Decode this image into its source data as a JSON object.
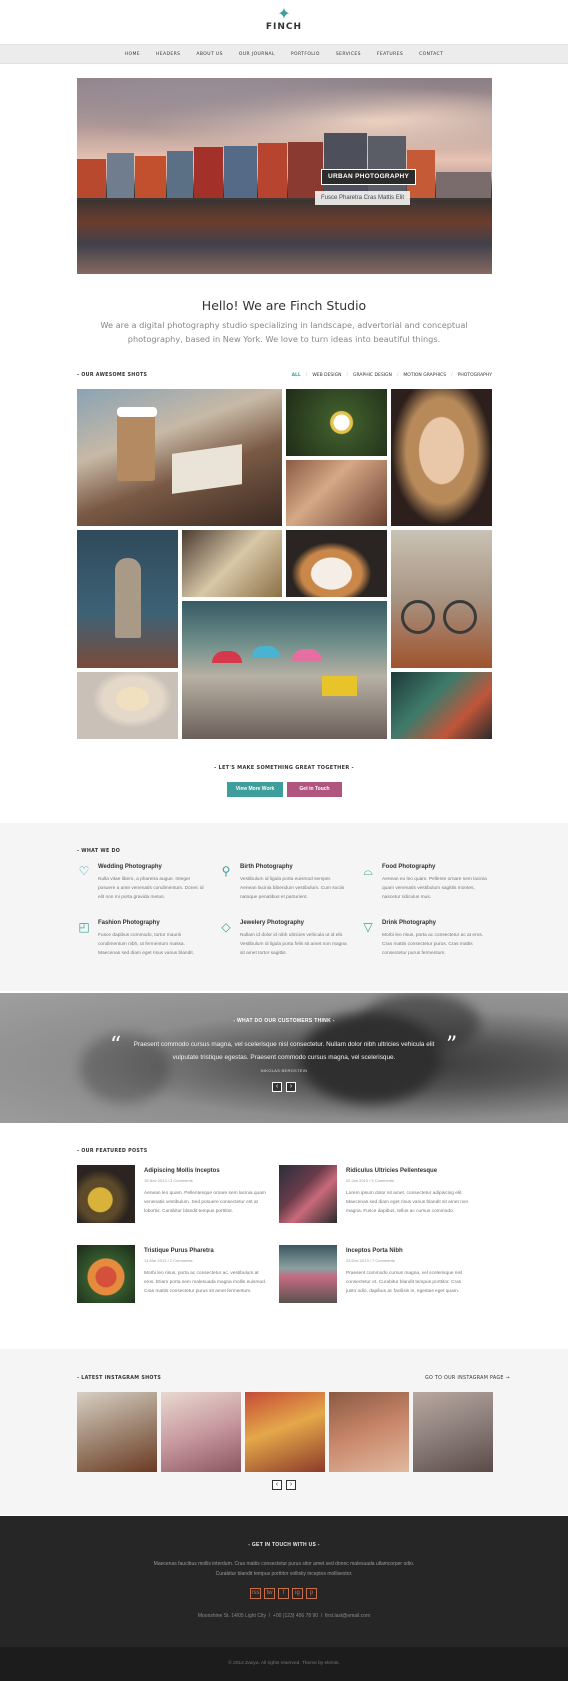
{
  "brand": {
    "logo_text": "FINCH",
    "accent": "#3e9e9c",
    "accent2": "#b0567e"
  },
  "nav": [
    "HOME",
    "HEADERS",
    "ABOUT US",
    "OUR JOURNAL",
    "PORTFOLIO",
    "SERVICES",
    "FEATURES",
    "CONTACT"
  ],
  "hero": {
    "title": "URBAN PHOTOGRAPHY",
    "subtitle": "Fusce Pharetra Cras Mattis Elit"
  },
  "intro": {
    "heading": "Hello! We are Finch Studio",
    "text": "We are a digital photography studio specializing in landscape, advertorial and conceptual photography, based in New York. We love to turn ideas into beautiful things."
  },
  "portfolio": {
    "label": "- OUR AWESOME SHOTS",
    "filters": [
      "ALL",
      "WEB DESIGN",
      "GRAPHIC DESIGN",
      "MOTION GRAPHICS",
      "PHOTOGRAPHY"
    ]
  },
  "cta": {
    "heading": "- LET'S MAKE SOMETHING GREAT TOGETHER -",
    "btn_work": "View More Work",
    "btn_touch": "Get in Touch"
  },
  "services": {
    "label": "- WHAT WE DO",
    "items": [
      {
        "title": "Wedding Photography",
        "icon": "heart-icon",
        "desc": "Nulla vitae libero, a pharetra augue. Integer posuere a ante venenatis condimentum. Donec id elit non mi porta gravida metus."
      },
      {
        "title": "Birth Photography",
        "icon": "lightbulb-icon",
        "desc": "Vestibulum id ligula porta euismod semper. Aenean lacinia bibendum vestibulum. Cum sociis natoque penatibus et parturient."
      },
      {
        "title": "Food Photography",
        "icon": "cloche-icon",
        "desc": "Aenean eu leo quam. Pellente ornare sem lacinia quam venenatis vestibulum sagittis montes, nascetur ridiculus mus."
      },
      {
        "title": "Fashion Photography",
        "icon": "bag-icon",
        "desc": "Fusce dapibus commodo, tortor mauris condimentum nibh, ut fermentum massa. Maecenas sed diam eget risus varius blandit."
      },
      {
        "title": "Jewelery Photography",
        "icon": "diamond-icon",
        "desc": "Nullam id dolor id nibh ultricies vehicula ut id elit. Vestibulum id ligula porta felis sit amet non magna sit amet tortor sagittis."
      },
      {
        "title": "Drink Photography",
        "icon": "cocktail-icon",
        "desc": "Morbi leo risus, porta ac consectetur ac at eros. Cras mattis consectetur purus. Cras mattis consectetur purus fermentum."
      }
    ]
  },
  "testimonial": {
    "heading": "- WHAT DO OUR CUSTOMERS THINK -",
    "quote": "Praesent commodo cursus magna, vel scelerisque nisl consectetur. Nullam dolor nibh ultricies vehicula elit vulputate tristique egestas. Praesent commodo cursus magna, vel scelerisque.",
    "author": "NIKOLAS BERGSTEIN"
  },
  "posts": {
    "label": "- OUR FEATURED POSTS",
    "items": [
      {
        "title": "Adipiscing Mollis Inceptos",
        "meta": "15 Nov 2013  /  3 Comments",
        "desc": "Aenean leo quam. Pellentesque ornare sem lacinia quam venenatis vestibulum. Sed posuere consectetur est at lobortis. Curabitur blandit tempus porttitor."
      },
      {
        "title": "Ridiculus Ultricies Pellentesque",
        "meta": "02 Jan 2013  /  5 Comments",
        "desc": "Lorem ipsum dolor sit amet, consectetur adipiscing elit. Maecenas sed diam eget risus varius blandit sit amet non magna. Fusce dapibus, tellus ac cursus commodo."
      },
      {
        "title": "Tristique Purus Pharetra",
        "meta": "14 Mar 2013  /  2 Comments",
        "desc": "Morbi leo risus, porta ac consectetur ac, vestibulum at eros. Etiam porta sem malesuada magna mollis euismod. Cras mattis consectetur purus sit amet fermentum."
      },
      {
        "title": "Inceptos Porta Nibh",
        "meta": "23 Dec 2013  /  7 Comments",
        "desc": "Praesent commodo cursus magna, vel scelerisque nisl consectetur et. Curabitur blandit tempus porttitor. Cras justo odio, dapibus ac facilisis in, egestas eget quam."
      }
    ]
  },
  "instagram": {
    "label": "- LATEST INSTAGRAM SHOTS",
    "link": "GO TO OUR INSTAGRAM PAGE →"
  },
  "footer": {
    "heading": "- GET IN TOUCH WITH US -",
    "text": "Maecenas faucibus mollis interdum. Cras mattis consectetur purus sitor amet sed donec malesuada ullamcorper odio. Curabitur blandit tempus porttitor vollisky inceptos mollisestor.",
    "address": "Moonshine St. 14/05 Light City",
    "phone": "+00 (123) 456 78 90",
    "email": "first.last@email.com",
    "social": [
      "rss",
      "tw",
      "f",
      "ig",
      "p"
    ],
    "copyright": "© 2014 Zanya. All rights reserved. Theme by elemis."
  }
}
